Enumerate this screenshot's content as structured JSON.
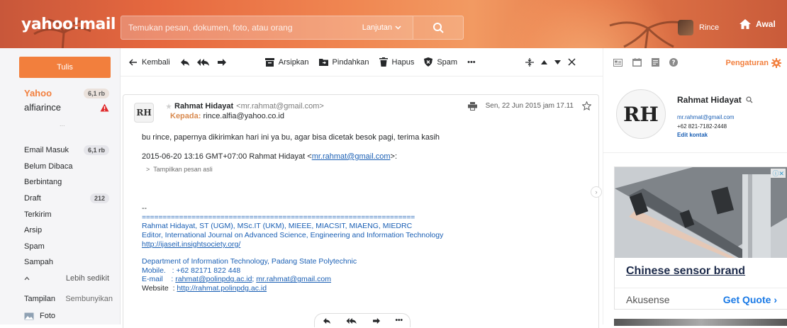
{
  "colors": {
    "accent": "#f27f3d",
    "link": "#1a5fb4",
    "header_gradient_start": "#c8573a",
    "header_gradient_end": "#c95b3a"
  },
  "header": {
    "logo": "yahoo!mail",
    "search_placeholder": "Temukan pesan, dokumen, foto, atau orang",
    "advanced_label": "Lanjutan",
    "user_name": "Rince",
    "home_label": "Awal"
  },
  "sidebar": {
    "compose_label": "Tulis",
    "accounts": [
      {
        "name": "Yahoo",
        "count": "6,1 rb"
      },
      {
        "name": "alfiarince",
        "count": ""
      }
    ],
    "dots": "...",
    "folders": [
      {
        "label": "Email Masuk",
        "count": "6,1 rb"
      },
      {
        "label": "Belum Dibaca",
        "count": ""
      },
      {
        "label": "Berbintang",
        "count": ""
      },
      {
        "label": "Draft",
        "count": "212"
      },
      {
        "label": "Terkirim",
        "count": ""
      },
      {
        "label": "Arsip",
        "count": ""
      },
      {
        "label": "Spam",
        "count": ""
      },
      {
        "label": "Sampah",
        "count": ""
      }
    ],
    "less_label": "Lebih sedikit",
    "view_label": "Tampilan",
    "hide_label": "Sembunyikan",
    "photo_label": "Foto"
  },
  "toolbar": {
    "back_label": "Kembali",
    "archive_label": "Arsipkan",
    "move_label": "Pindahkan",
    "delete_label": "Hapus",
    "spam_label": "Spam",
    "more_label": "•••"
  },
  "message": {
    "sender_initials": "RH",
    "sender_name": "Rahmat Hidayat",
    "sender_email": "<mr.rahmat@gmail.com>",
    "to_label": "Kepada:",
    "to_value": "rince.alfia@yahoo.co.id",
    "date": "Sen, 22 Jun 2015 jam 17.11",
    "body_line": "bu rince, papernya dikirimkan hari ini ya bu, agar bisa dicetak besok pagi, terima kasih",
    "quote_header": "2015-06-20 13:16 GMT+07:00 Rahmat Hidayat <",
    "quote_email": "mr.rahmat@gmail.com",
    "quote_tail": ">:",
    "show_original": "Tampilkan pesan asli",
    "sig_dash": "--",
    "sig_line": "==================================================================",
    "sig_name": "Rahmat Hidayat, ST (UGM), MSc.IT (UKM), MIEEE, MIACSIT, MIAENG, MIEDRC",
    "sig_editor": "Editor, International Journal on Advanced Science, Engineering and Information Technology",
    "sig_url": "http://ijaseit.insightsociety.org/",
    "sig_dept": "Department of Information Technology, Padang State Polytechnic",
    "sig_mobile": "Mobile.   : +62 82171 822 448",
    "sig_email_label": "E-mail    : ",
    "sig_email_1": "rahmat@polinpdg.ac.id",
    "sig_email_sep": "; ",
    "sig_email_2": "mr.rahmat@gmail.com",
    "sig_web_label": "Website  : ",
    "sig_web": "http://rahmat.polinpdg.ac.id"
  },
  "right_panel": {
    "settings_label": "Pengaturan",
    "contact_name": "Rahmat Hidayat",
    "contact_initials": "RH",
    "contact_email": "mr.rahmat@gmail.com",
    "contact_phone": "+62 821-7182-2448",
    "edit_label": "Edit kontak",
    "ad_headline": "Chinese sensor brand",
    "ad_brand": "Akusense",
    "ad_cta": "Get Quote"
  }
}
